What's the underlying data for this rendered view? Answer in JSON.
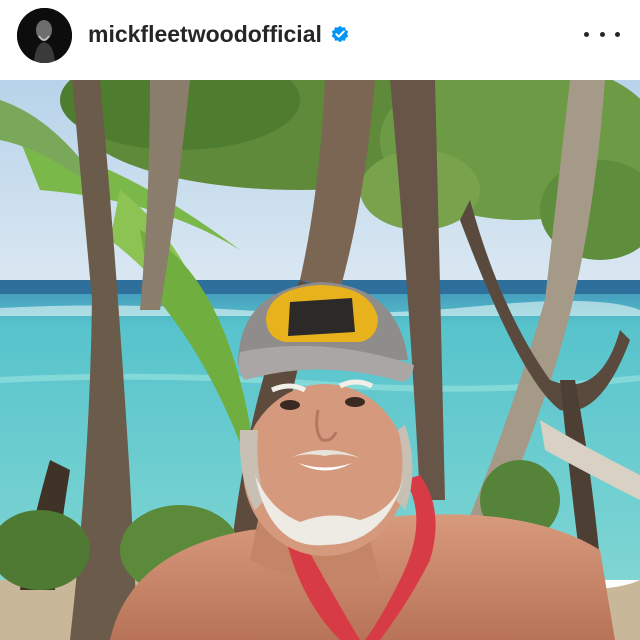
{
  "post": {
    "username": "mickfleetwoodofficial",
    "verified": true,
    "avatar": "profile-avatar",
    "more_icon": "more-options-icon",
    "photo": "beach-palm-trees-portrait-photo"
  },
  "colors": {
    "header_bg": "#ffffff",
    "username_text": "#262626",
    "verified_badge": "#0095f6",
    "sky": "#c8dcef",
    "ocean": "#5ec9cf",
    "sand": "#c9b79a"
  }
}
